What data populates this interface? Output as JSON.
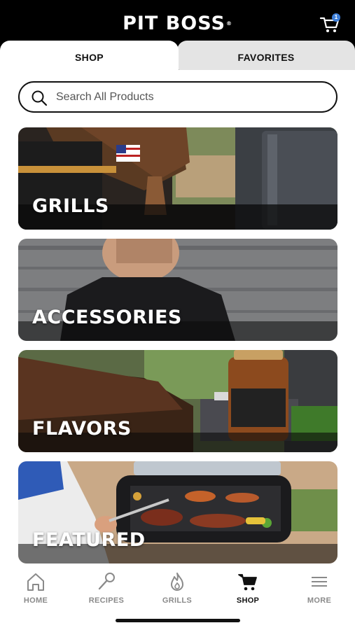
{
  "header": {
    "brand": "PIT BOSS",
    "cart_count": "1"
  },
  "tabs": [
    {
      "label": "SHOP",
      "active": true
    },
    {
      "label": "FAVORITES",
      "active": false
    }
  ],
  "search": {
    "placeholder": "Search All Products",
    "value": ""
  },
  "categories": [
    {
      "label": "GRILLS"
    },
    {
      "label": "ACCESSORIES"
    },
    {
      "label": "FLAVORS"
    },
    {
      "label": "FEATURED"
    }
  ],
  "bottom_nav": [
    {
      "label": "HOME",
      "icon": "home-icon"
    },
    {
      "label": "RECIPES",
      "icon": "spatula-icon"
    },
    {
      "label": "GRILLS",
      "icon": "flame-icon"
    },
    {
      "label": "SHOP",
      "icon": "cart-icon",
      "active": true
    },
    {
      "label": "MORE",
      "icon": "menu-icon"
    }
  ],
  "colors": {
    "header": "#000000",
    "inactive_tab": "#e4e4e4",
    "badge": "#3d7fd9",
    "nav_inactive": "#8a8a8a"
  }
}
